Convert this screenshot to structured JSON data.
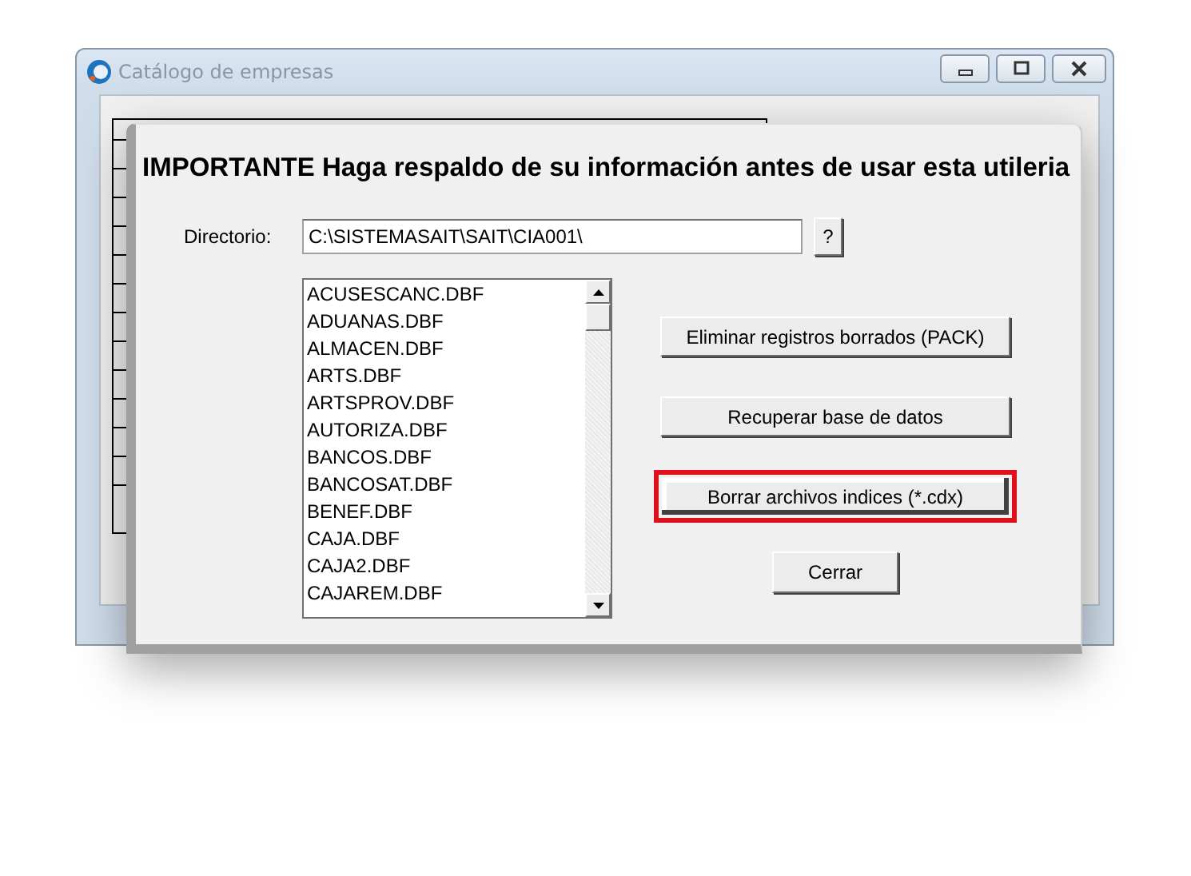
{
  "window": {
    "title": "Catálogo de empresas"
  },
  "dialog": {
    "heading": "IMPORTANTE Haga respaldo de su información antes de usar esta utileria",
    "directory": {
      "label": "Directorio:",
      "value": "C:\\SISTEMASAIT\\SAIT\\CIA001\\",
      "browse": "?"
    },
    "files": [
      {
        "name": "ACUSESCANC.DBF",
        "selected": false
      },
      {
        "name": "ADUANAS.DBF",
        "selected": false
      },
      {
        "name": "ALMACEN.DBF",
        "selected": false
      },
      {
        "name": "ARTS.DBF",
        "selected": false
      },
      {
        "name": "ARTSPROV.DBF",
        "selected": false
      },
      {
        "name": "AUTORIZA.DBF",
        "selected": false
      },
      {
        "name": "BANCOS.DBF",
        "selected": false
      },
      {
        "name": "BANCOSAT.DBF",
        "selected": false
      },
      {
        "name": "BENEF.DBF",
        "selected": false
      },
      {
        "name": "CAJA.DBF",
        "selected": false
      },
      {
        "name": "CAJA2.DBF",
        "selected": false
      },
      {
        "name": "CAJAREM.DBF",
        "selected": false
      }
    ],
    "buttons": [
      {
        "label": "Eliminar registros borrados  (PACK)",
        "highlighted": false
      },
      {
        "label": "Recuperar base de datos",
        "highlighted": false
      },
      {
        "label": "Borrar archivos indices (*.cdx)",
        "highlighted": true
      },
      {
        "label": "Cerrar",
        "highlighted": false
      }
    ]
  }
}
